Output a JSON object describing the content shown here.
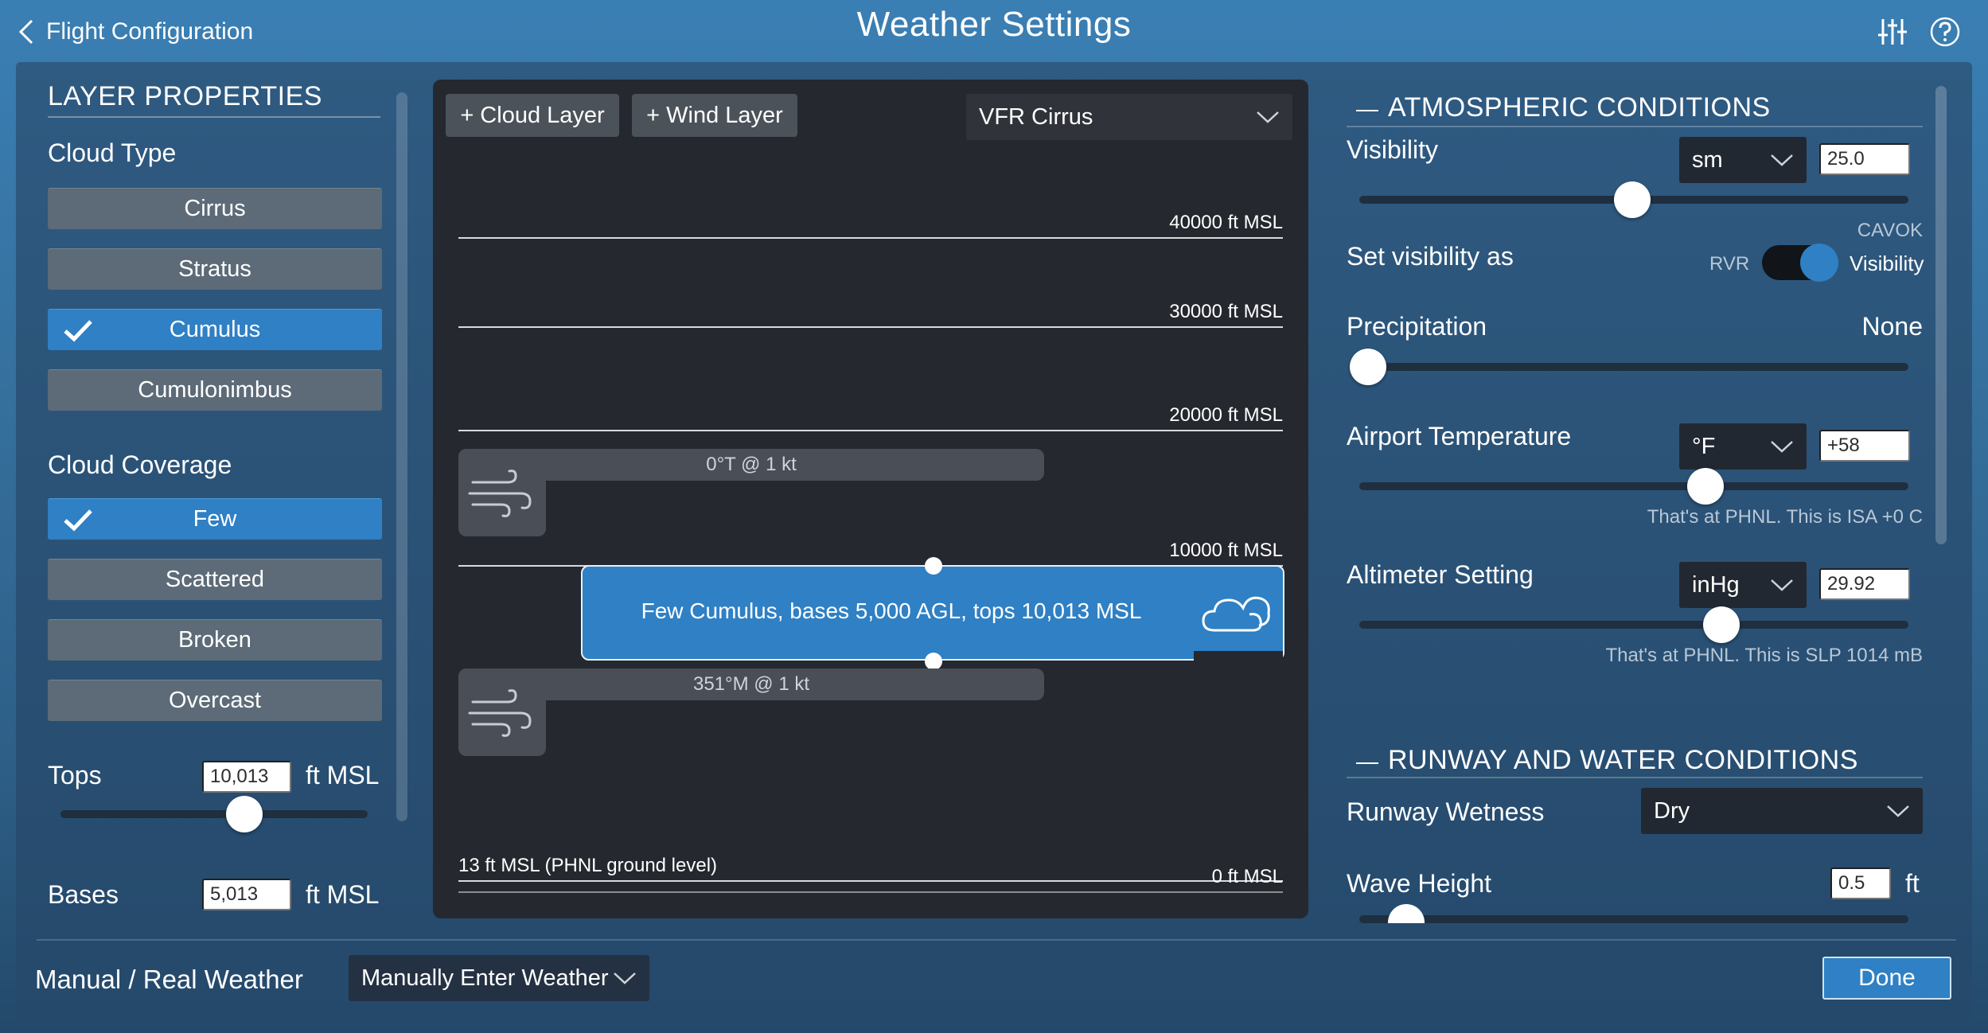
{
  "header": {
    "back_label": "Flight Configuration",
    "title": "Weather Settings",
    "icons": [
      "back-chevron-icon",
      "equalizer-icon",
      "help-icon"
    ]
  },
  "layer_properties": {
    "title": "LAYER PROPERTIES",
    "cloud_type": {
      "label": "Cloud Type",
      "options": [
        "Cirrus",
        "Stratus",
        "Cumulus",
        "Cumulonimbus"
      ],
      "selected": "Cumulus"
    },
    "cloud_coverage": {
      "label": "Cloud Coverage",
      "options": [
        "Few",
        "Scattered",
        "Broken",
        "Overcast"
      ],
      "selected": "Few"
    },
    "tops": {
      "label": "Tops",
      "value": "10,013",
      "unit": "ft MSL",
      "slider_fraction": 0.6
    },
    "bases": {
      "label": "Bases",
      "value": "5,013",
      "unit": "ft MSL"
    }
  },
  "layers": {
    "add_cloud_label": "+ Cloud Layer",
    "add_wind_label": "+ Wind Layer",
    "preset": "VFR Cirrus",
    "altitudes": [
      "40000 ft MSL",
      "30000 ft MSL",
      "20000 ft MSL",
      "10000 ft MSL",
      "0 ft MSL"
    ],
    "ground_label": "13 ft MSL (PHNL ground level)",
    "wind_upper": "0°T @ 1 kt",
    "wind_lower": "351°M @ 1 kt",
    "cloud_layer_label": "Few Cumulus, bases 5,000 AGL, tops 10,013 MSL"
  },
  "atmospheric": {
    "title": "ATMOSPHERIC CONDITIONS",
    "visibility": {
      "label": "Visibility",
      "unit": "sm",
      "value": "25.0",
      "slider_fraction": 0.5
    },
    "cavok": "CAVOK",
    "set_visibility": {
      "label": "Set visibility as",
      "left": "RVR",
      "right": "Visibility",
      "state": "Visibility"
    },
    "precipitation": {
      "label": "Precipitation",
      "value": "None",
      "slider_fraction": 0.0
    },
    "temperature": {
      "label": "Airport Temperature",
      "unit": "°F",
      "value": "+58",
      "note": "That's at PHNL. This is ISA +0 C",
      "slider_fraction": 0.63
    },
    "altimeter": {
      "label": "Altimeter Setting",
      "unit": "inHg",
      "value": "29.92",
      "note": "That's at PHNL. This is SLP 1014 mB",
      "slider_fraction": 0.66
    }
  },
  "runway": {
    "title": "RUNWAY AND WATER CONDITIONS",
    "wetness": {
      "label": "Runway Wetness",
      "value": "Dry"
    },
    "wave": {
      "label": "Wave Height",
      "value": "0.5",
      "unit": "ft"
    }
  },
  "bottom": {
    "mode_label": "Manual / Real Weather",
    "mode_value": "Manually Enter Weather",
    "done_label": "Done"
  },
  "colors": {
    "selected_blue": "#2f80c4",
    "panel_dark": "#25282e",
    "button_gray": "#5d6b78"
  }
}
